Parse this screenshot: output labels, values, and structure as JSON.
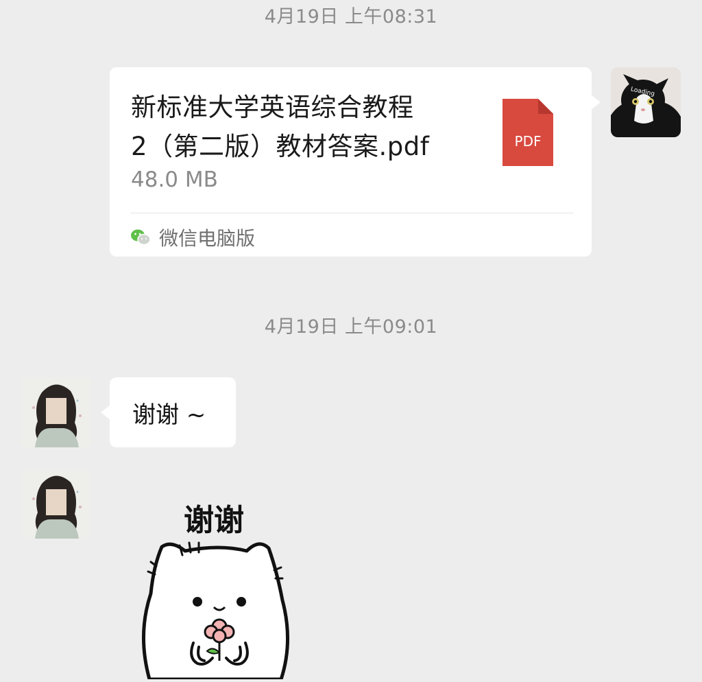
{
  "messages": [
    {
      "timestamp": "4月19日 上午08:31",
      "sender": "self",
      "type": "file",
      "file": {
        "name": "新标准大学英语综合教程2（第二版）教材答案.pdf",
        "name_line1": "新标准大学英语综合教程",
        "name_line2": "2（第二版）教材答案.pdf",
        "size": "48.0 MB",
        "icon_label": "PDF",
        "source": "微信电脑版"
      },
      "avatar_text": "Loading"
    },
    {
      "timestamp": "4月19日 上午09:01",
      "sender": "other",
      "type": "text",
      "text": "谢谢 ~"
    },
    {
      "sender": "other",
      "type": "sticker",
      "sticker_text": "谢谢"
    }
  ],
  "colors": {
    "background": "#ededed",
    "bubble": "#ffffff",
    "timestamp": "#8a8a8a",
    "pdf_red": "#d8493e",
    "wechat_green": "#5fc04a"
  }
}
